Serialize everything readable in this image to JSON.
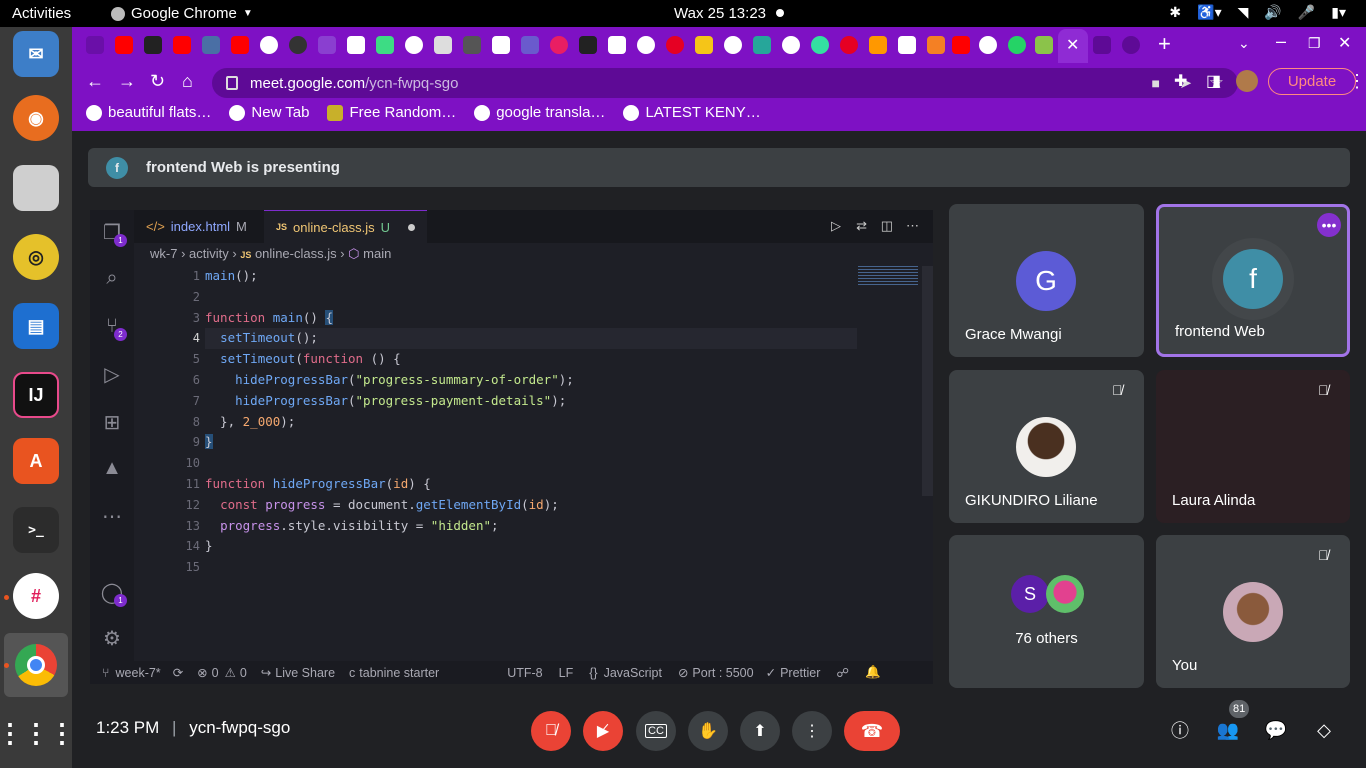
{
  "system": {
    "activities": "Activities",
    "app_name": "Google Chrome",
    "clock": "Wax 25  13:23"
  },
  "browser": {
    "url_host": "meet.google.com",
    "url_path": "/ycn-fwpq-sgo",
    "update_label": "Update",
    "bookmarks": [
      "beautiful flats…",
      "New Tab",
      "Free Random…",
      "google transla…",
      "LATEST KENY…"
    ]
  },
  "banner": {
    "avatar_letter": "f",
    "text": "frontend Web is presenting"
  },
  "editor": {
    "tabs": [
      {
        "label": "index.html",
        "status": "M"
      },
      {
        "label": "online-class.js",
        "status": "U"
      }
    ],
    "breadcrumb": [
      "wk-7",
      "activity",
      "online-class.js",
      "main"
    ],
    "line_numbers": [
      "1",
      "2",
      "3",
      "4",
      "5",
      "6",
      "7",
      "8",
      "9",
      "10",
      "11",
      "12",
      "13",
      "14",
      "15"
    ],
    "explorer_badge": "1",
    "scm_badge": "2",
    "account_badge": "1",
    "status": {
      "branch": "week-7*",
      "problems_errors": "0",
      "problems_warnings": "0",
      "live_share": "Live Share",
      "tabnine": "tabnine starter",
      "encoding": "UTF-8",
      "eol": "LF",
      "language": "JavaScript",
      "port": "Port : 5500",
      "prettier": "Prettier"
    }
  },
  "participants": {
    "grace": {
      "name": "Grace Mwangi",
      "initial": "G"
    },
    "frontend": {
      "name": "frontend Web",
      "initial": "f"
    },
    "gikundiro": {
      "name": "GIKUNDIRO Liliane"
    },
    "laura": {
      "name": "Laura Alinda"
    },
    "others": {
      "label": "76 others",
      "initial": "S"
    },
    "you": {
      "name": "You"
    }
  },
  "controls": {
    "time": "1:23 PM",
    "separator": "|",
    "meeting_code": "ycn-fwpq-sgo",
    "people_count": "81"
  },
  "colors": {
    "chrome_purple": "#7e11c4",
    "end_call_red": "#ea4335",
    "grace_avatar": "#5c5bd6",
    "frontend_avatar": "#3f8ea6",
    "others_avatar": "#5b1fa8"
  }
}
